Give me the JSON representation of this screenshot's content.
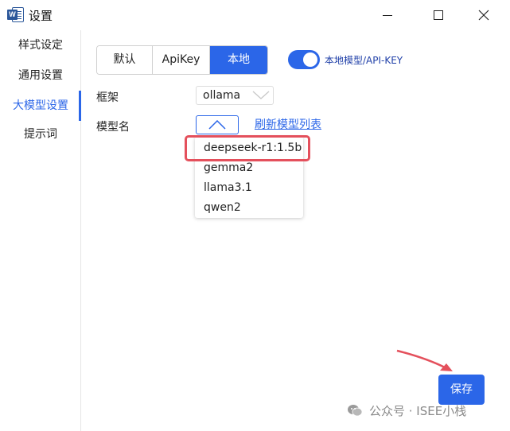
{
  "window": {
    "title": "设置",
    "app_icon": "word-icon",
    "app_icon_letter": "W"
  },
  "sidebar": {
    "items": [
      {
        "label": "样式设定"
      },
      {
        "label": "通用设置"
      },
      {
        "label": "大模型设置",
        "active": true
      },
      {
        "label": "提示词"
      }
    ]
  },
  "mode_tabs": {
    "options": [
      "默认",
      "ApiKey",
      "本地"
    ],
    "selected": "本地"
  },
  "local_toggle": {
    "on": true,
    "label": "本地模型/API-KEY"
  },
  "framework": {
    "label": "框架",
    "value": "ollama"
  },
  "model": {
    "label": "模型名",
    "value": "",
    "refresh_label": "刷新模型列表",
    "options": [
      "deepseek-r1:1.5b",
      "gemma2",
      "llama3.1",
      "qwen2"
    ],
    "highlighted": "deepseek-r1:1.5b"
  },
  "footer": {
    "save_label": "保存"
  },
  "watermark": {
    "text": "公众号 · ISEE小栈"
  },
  "colors": {
    "accent": "#2b66e8",
    "highlight_box": "#e4505c"
  }
}
